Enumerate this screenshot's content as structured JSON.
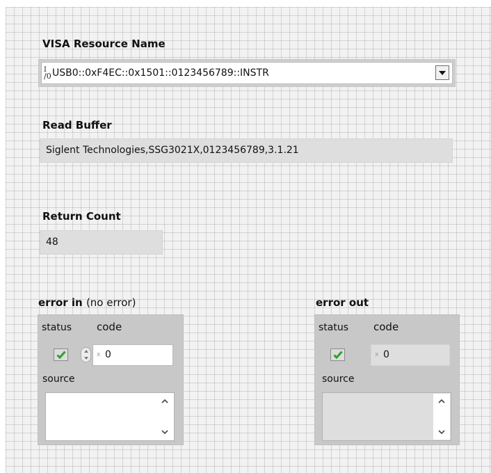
{
  "visa_resource": {
    "label": "VISA Resource Name",
    "io_glyph": "I/0",
    "value": "USB0::0xF4EC::0x1501::0123456789::INSTR",
    "dropdown_icon": "triangle-down"
  },
  "read_buffer": {
    "label": "Read Buffer",
    "value": "Siglent Technologies,SSG3021X,0123456789,3.1.21"
  },
  "return_count": {
    "label": "Return Count",
    "value": "48"
  },
  "error_in": {
    "label": "error in",
    "label_note": "(no error)",
    "status_label": "status",
    "code_label": "code",
    "code_value": "0",
    "radix": "x",
    "source_label": "source",
    "source_value": "",
    "status_icon": "green-check"
  },
  "error_out": {
    "label": "error out",
    "status_label": "status",
    "code_label": "code",
    "code_value": "0",
    "radix": "x",
    "source_label": "source",
    "source_value": "",
    "status_icon": "green-check"
  },
  "colors": {
    "panel_grid": "#f2f2f2",
    "indicator_bg": "#dedede",
    "control_bg": "#ffffff",
    "status_check": "#2e9e2e"
  }
}
